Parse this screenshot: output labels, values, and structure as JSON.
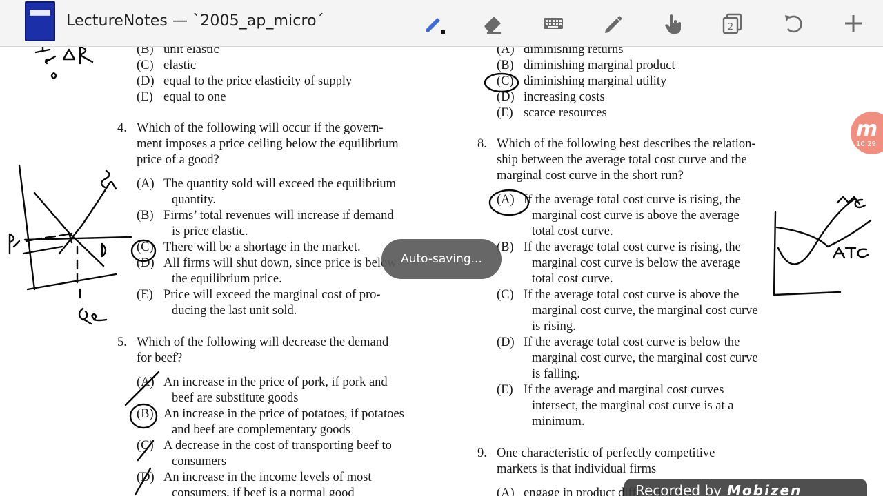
{
  "toolbar": {
    "title": "LectureNotes — `2005_ap_micro´",
    "buttons": [
      {
        "name": "pen-tool-button",
        "icon": "pen-icon"
      },
      {
        "name": "eraser-tool-button",
        "icon": "eraser-icon"
      },
      {
        "name": "keyboard-tool-button",
        "icon": "keyboard-icon"
      },
      {
        "name": "pencil-tool-button",
        "icon": "pencil-icon"
      },
      {
        "name": "hand-tool-button",
        "icon": "hand-pointer-icon"
      },
      {
        "name": "page-count-button",
        "icon": "pages-icon",
        "value": "2"
      },
      {
        "name": "undo-button",
        "icon": "undo-icon"
      },
      {
        "name": "add-page-button",
        "icon": "plus-icon"
      }
    ],
    "accent_color": "#3f6ad8"
  },
  "document": {
    "left_column": {
      "q3_tail_options": [
        {
          "letter": "(B)",
          "text": "unit elastic"
        },
        {
          "letter": "(C)",
          "text": "elastic"
        },
        {
          "letter": "(D)",
          "text": "equal to the price elasticity of supply"
        },
        {
          "letter": "(E)",
          "text": "equal to one"
        }
      ],
      "q4": {
        "number": "4.",
        "stem": [
          "Which of the following will occur if the govern-",
          "ment imposes a price ceiling below the equilibrium",
          "price of a good?"
        ],
        "options": [
          {
            "letter": "(A)",
            "lines": [
              "The quantity sold will exceed the equilibrium",
              "quantity."
            ]
          },
          {
            "letter": "(B)",
            "lines": [
              "Firms’ total revenues will increase if demand",
              "is price elastic."
            ]
          },
          {
            "letter": "(C)",
            "lines": [
              "There will be a shortage in the market."
            ]
          },
          {
            "letter": "(D)",
            "lines": [
              "All firms will shut down, since price is below",
              "the equilibrium price."
            ]
          },
          {
            "letter": "(E)",
            "lines": [
              "Price will exceed the marginal cost of pro-",
              "ducing the last unit sold."
            ]
          }
        ]
      },
      "q5": {
        "number": "5.",
        "stem": [
          "Which of the following will decrease the demand",
          "for beef?"
        ],
        "options": [
          {
            "letter": "(A)",
            "lines": [
              "An increase in the price of pork, if pork and",
              "beef are substitute goods"
            ]
          },
          {
            "letter": "(B)",
            "lines": [
              "An increase in the price of potatoes, if potatoes",
              "and beef are complementary goods"
            ]
          },
          {
            "letter": "(C)",
            "lines": [
              "A decrease in the cost of transporting beef to",
              "consumers"
            ]
          },
          {
            "letter": "(D)",
            "lines": [
              "An increase in the income levels of most",
              "consumers, if beef is a normal good"
            ]
          }
        ]
      }
    },
    "right_column": {
      "q7_tail_options": [
        {
          "letter": "(A)",
          "text": "diminishing returns"
        },
        {
          "letter": "(B)",
          "text": "diminishing marginal product"
        },
        {
          "letter": "(C)",
          "text": "diminishing marginal utility"
        },
        {
          "letter": "(D)",
          "text": "increasing costs"
        },
        {
          "letter": "(E)",
          "text": "scarce resources"
        }
      ],
      "q8": {
        "number": "8.",
        "stem": [
          "Which of the following best describes the relation-",
          "ship between the average total cost curve and the",
          "marginal cost curve in the short run?"
        ],
        "options": [
          {
            "letter": "(A)",
            "lines": [
              "If the average total cost curve is rising, the",
              "marginal cost curve is above the average",
              "total cost curve."
            ]
          },
          {
            "letter": "(B)",
            "lines": [
              "If the average total cost curve is rising, the",
              "marginal cost curve is below the average",
              "total cost curve."
            ]
          },
          {
            "letter": "(C)",
            "lines": [
              "If the average total cost curve is above the",
              "marginal cost curve, the marginal cost curve",
              "is rising."
            ]
          },
          {
            "letter": "(D)",
            "lines": [
              "If the average total cost curve is below the",
              "marginal cost curve, the marginal cost curve",
              "is falling."
            ]
          },
          {
            "letter": "(E)",
            "lines": [
              "If the average and marginal cost curves",
              "intersect, the marginal cost curve is at a",
              "minimum."
            ]
          }
        ]
      },
      "q9": {
        "number": "9.",
        "stem": [
          "One characteristic of perfectly competitive",
          "markets is that individual firms"
        ],
        "options": [
          {
            "letter": "(A)",
            "lines": [
              "engage in product differentiation"
            ]
          }
        ]
      }
    }
  },
  "annotations": {
    "top_left_note": "%ΔP",
    "supply_label": "S",
    "demand_label": "D",
    "price_label": "Pc",
    "quantity_label": "Qe",
    "mc_label": "MC",
    "atc_label": "ATC",
    "circled_answers": [
      "Q4 (C)",
      "Q5 (B)",
      "Q7 (C)",
      "Q8 (A)"
    ],
    "crossed_out": [
      "Q5 (A)",
      "Q5 (C)",
      "Q5 (D)"
    ]
  },
  "toast": {
    "text": "Auto-saving..."
  },
  "recorder_badge": {
    "letter": "m",
    "time": "10:29",
    "color": "#f08e80"
  },
  "watermark": {
    "prefix": "Recorded by",
    "brand": "Mobizen"
  }
}
